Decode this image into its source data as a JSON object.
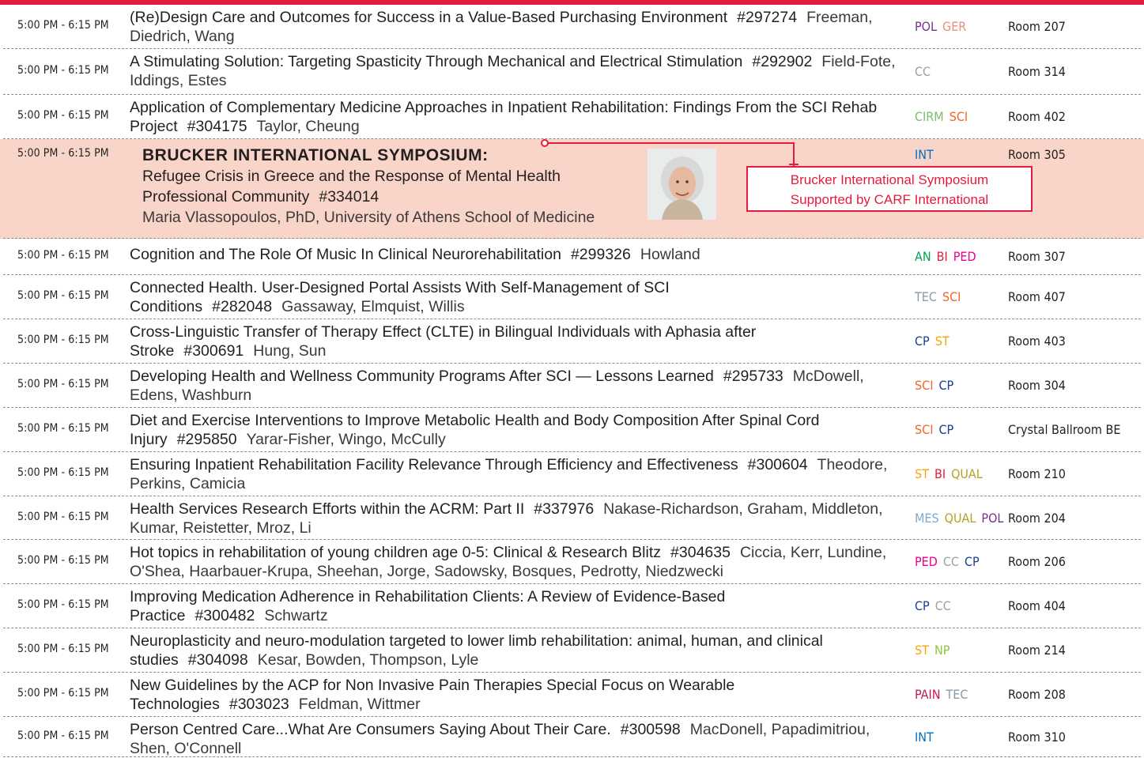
{
  "colors": {
    "accent": "#e31c3d",
    "featured_bg": "#f9d5c9",
    "tracks": {
      "POL": "#7b2f8e",
      "GER": "#f08c7c",
      "CC": "#9aa0a6",
      "CIRM": "#7bbf6a",
      "SCI": "#f26522",
      "INT": "#0072bc",
      "AN": "#00a651",
      "BI": "#e31c3d",
      "PED": "#ec008c",
      "TEC": "#8a9aa6",
      "CP": "#1b3f8f",
      "ST": "#f7a600",
      "QUAL": "#b5a12a",
      "MES": "#7fa8c9",
      "NP": "#8dc63f",
      "PAIN": "#c2185b"
    }
  },
  "featured": {
    "time": "5:00 PM - 6:15 PM",
    "heading": "BRUCKER INTERNATIONAL SYMPOSIUM:",
    "title_line1": "Refugee Crisis in Greece and the Response of Mental Health",
    "title_line2": "Professional Community",
    "number": "#334014",
    "speaker": "Maria Vlassopoulos, PhD, University of Athens School of Medicine",
    "tracks": [
      "INT"
    ],
    "room": "Room 305",
    "callout_line1": "Brucker International Symposium",
    "callout_line2": "Supported by CARF International",
    "photo_icon": "speaker-portrait"
  },
  "sessions": [
    {
      "time": "5:00 PM - 6:15 PM",
      "title": "(Re)Design Care and Outcomes for Success in a Value-Based Purchasing Environment",
      "number": "#297274",
      "authors": "Freeman, Diedrich, Wang",
      "tracks": [
        "POL",
        "GER"
      ],
      "room": "Room 207"
    },
    {
      "time": "5:00 PM - 6:15 PM",
      "title": "A Stimulating Solution: Targeting Spasticity Through Mechanical and Electrical Stimulation",
      "number": "#292902",
      "authors": "Field-Fote, Iddings, Estes",
      "tracks": [
        "CC"
      ],
      "room": "Room 314"
    },
    {
      "time": "5:00 PM - 6:15 PM",
      "title": "Application of Complementary Medicine Approaches in Inpatient Rehabilitation: Findings From the SCI Rehab Project",
      "number": "#304175",
      "authors": "Taylor, Cheung",
      "tracks": [
        "CIRM",
        "SCI"
      ],
      "room": "Room 402"
    },
    {
      "time": "5:00 PM - 6:15 PM",
      "title": "Cognition and The Role Of Music In Clinical Neurorehabilitation",
      "number": "#299326",
      "authors": "Howland",
      "tracks": [
        "AN",
        "BI",
        "PED"
      ],
      "room": "Room 307"
    },
    {
      "time": "5:00 PM - 6:15 PM",
      "title": "Connected Health. User-Designed Portal Assists With Self-Management of SCI Conditions",
      "number": "#282048",
      "authors": "Gassaway, Elmquist, Willis",
      "tracks": [
        "TEC",
        "SCI"
      ],
      "room": "Room 407"
    },
    {
      "time": "5:00 PM - 6:15 PM",
      "title": "Cross-Linguistic Transfer of Therapy Effect (CLTE) in Bilingual Individuals with Aphasia after Stroke",
      "number": "#300691",
      "authors": "Hung, Sun",
      "tracks": [
        "CP",
        "ST"
      ],
      "room": "Room 403"
    },
    {
      "time": "5:00 PM - 6:15 PM",
      "title": "Developing Health and Wellness  Community Programs After SCI — Lessons Learned",
      "number": "#295733",
      "authors": "McDowell, Edens, Washburn",
      "tracks": [
        "SCI",
        "CP"
      ],
      "room": "Room 304"
    },
    {
      "time": "5:00 PM - 6:15 PM",
      "title": "Diet and Exercise Interventions to Improve  Metabolic Health and Body Composition After Spinal Cord Injury",
      "number": "#295850",
      "authors": "Yarar-Fisher, Wingo, McCully",
      "tracks": [
        "SCI",
        "CP"
      ],
      "room": "Crystal Ballroom BE"
    },
    {
      "time": "5:00 PM - 6:15 PM",
      "title": "Ensuring Inpatient Rehabilitation Facility Relevance Through Efficiency and Effectiveness",
      "number": "#300604",
      "authors": "Theodore, Perkins, Camicia",
      "tracks": [
        "ST",
        "BI",
        "QUAL"
      ],
      "room": "Room 210"
    },
    {
      "time": "5:00 PM - 6:15 PM",
      "title": "Health Services Research Efforts within the ACRM: Part II",
      "number": "#337976",
      "authors": "Nakase-Richardson, Graham, Middleton, Kumar, Reistetter, Mroz, Li",
      "tracks": [
        "MES",
        "QUAL",
        "POL"
      ],
      "room": "Room 204"
    },
    {
      "time": "5:00 PM - 6:15 PM",
      "title": "Hot topics in rehabilitation of young children age 0-5: Clinical & Research Blitz",
      "number": "#304635",
      "authors": "Ciccia, Kerr, Lundine, O'Shea, Haarbauer-Krupa, Sheehan, Jorge, Sadowsky, Bosques, Pedrotty, Niedzwecki",
      "tracks": [
        "PED",
        "CC",
        "CP"
      ],
      "room": "Room 206"
    },
    {
      "time": "5:00 PM - 6:15 PM",
      "title": "Improving Medication Adherence in Rehabilitation Clients: A Review of Evidence-Based Practice",
      "number": "#300482",
      "authors": "Schwartz",
      "tracks": [
        "CP",
        "CC"
      ],
      "room": "Room 404"
    },
    {
      "time": "5:00 PM - 6:15 PM",
      "title": "Neuroplasticity and neuro-modulation targeted to lower limb rehabilitation: animal, human, and clinical studies",
      "number": "#304098",
      "authors": "Kesar, Bowden, Thompson, Lyle",
      "tracks": [
        "ST",
        "NP"
      ],
      "room": "Room 214"
    },
    {
      "time": "5:00 PM - 6:15 PM",
      "title": "New Guidelines by the ACP for Non Invasive Pain Therapies Special Focus on Wearable Technologies",
      "number": "#303023",
      "authors": "Feldman, Wittmer",
      "tracks": [
        "PAIN",
        "TEC"
      ],
      "room": "Room 208"
    },
    {
      "time": "5:00 PM - 6:15 PM",
      "title": "Person Centred Care...What Are Consumers Saying About Their Care.",
      "number": "#300598",
      "authors": "MacDonell, Papadimitriou, Shen, O'Connell",
      "tracks": [
        "INT"
      ],
      "room": "Room 310"
    }
  ]
}
